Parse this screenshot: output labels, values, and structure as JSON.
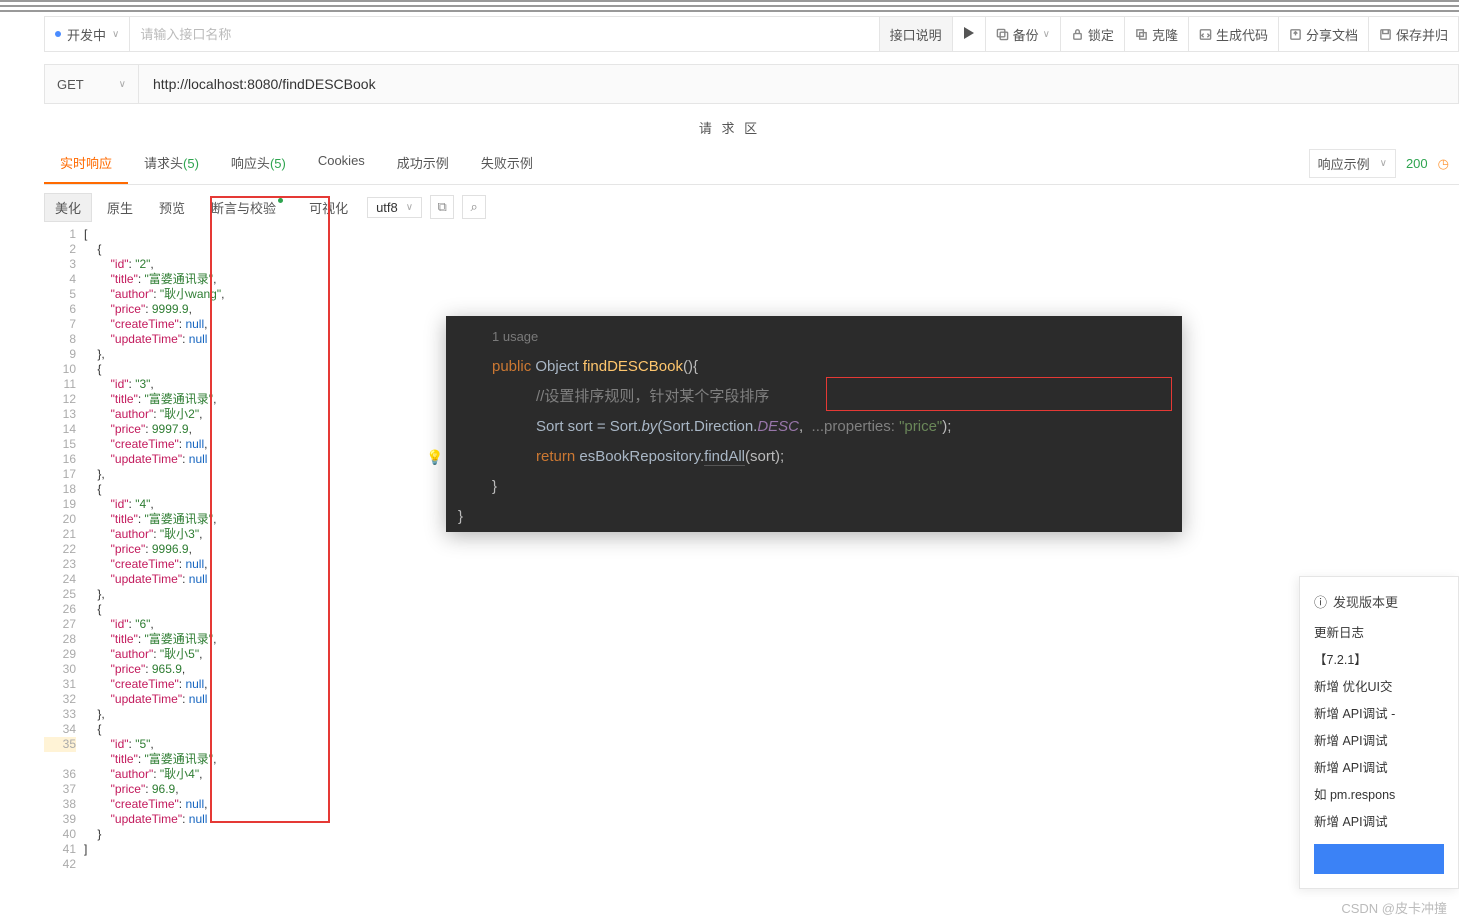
{
  "topbar": {
    "dev_label": "开发中",
    "input_placeholder": "请输入接口名称",
    "desc": "接口说明",
    "backup": "备份",
    "lock": "锁定",
    "clone": "克隆",
    "gencode": "生成代码",
    "sharedoc": "分享文档",
    "saveand": "保存并归"
  },
  "request": {
    "method": "GET",
    "url": "http://localhost:8080/findDESCBook",
    "section_label": "请 求 区"
  },
  "tabs": {
    "realtime": "实时响应",
    "req_header": "请求头",
    "req_header_count": "(5)",
    "resp_header": "响应头",
    "resp_header_count": "(5)",
    "cookies": "Cookies",
    "success": "成功示例",
    "failure": "失败示例",
    "resp_example": "响应示例",
    "status": "200"
  },
  "subbar": {
    "beautify": "美化",
    "raw": "原生",
    "preview": "预览",
    "assert": "断言与校验",
    "visual": "可视化",
    "encoding": "utf8"
  },
  "json": [
    {
      "id": "2",
      "title": "富婆通讯录",
      "author": "耿小wang",
      "price": 9999.9,
      "createTime": null,
      "updateTime": null
    },
    {
      "id": "3",
      "title": "富婆通讯录",
      "author": "耿小2",
      "price": 9997.9,
      "createTime": null,
      "updateTime": null
    },
    {
      "id": "4",
      "title": "富婆通讯录",
      "author": "耿小3",
      "price": 9996.9,
      "createTime": null,
      "updateTime": null
    },
    {
      "id": "6",
      "title": "富婆通讯录",
      "author": "耿小5",
      "price": 965.9,
      "createTime": null,
      "updateTime": null
    },
    {
      "id": "5",
      "title": "富婆通讯录",
      "author": "耿小4",
      "price": 96.9,
      "createTime": null,
      "updateTime": null
    }
  ],
  "ide": {
    "usage": "1 usage",
    "l1_public": "public",
    "l1_object": "Object",
    "l1_name": "findDESCBook",
    "l1_rest": "(){",
    "l2": "//设置排序规则，针对某个字段排序",
    "l3_a": "Sort sort = Sort.",
    "l3_by": "by",
    "l3_b": "(Sort.Direction.",
    "l3_desc": "DESC",
    "l3_c": ", ",
    "l3_param": "...properties:",
    "l3_str": " \"price\"",
    "l3_end": ");",
    "l4_ret": "return ",
    "l4_repo": "esBookRepository",
    "l4_dot": ".",
    "l4_find": "findAll",
    "l4_args": "(sort);",
    "l5": "}",
    "l6": "}"
  },
  "notif": {
    "title": "发现版本更",
    "changelog": "更新日志",
    "version": "【7.2.1】",
    "r1": "新增 优化UI交",
    "r2": "新增 API调试 -",
    "r3": "新增 API调试 ",
    "r4": "新增 API调试 ",
    "r4b": "如 pm.respons",
    "r5": "新增 API调试 "
  },
  "watermark": "CSDN @皮卡冲撞"
}
